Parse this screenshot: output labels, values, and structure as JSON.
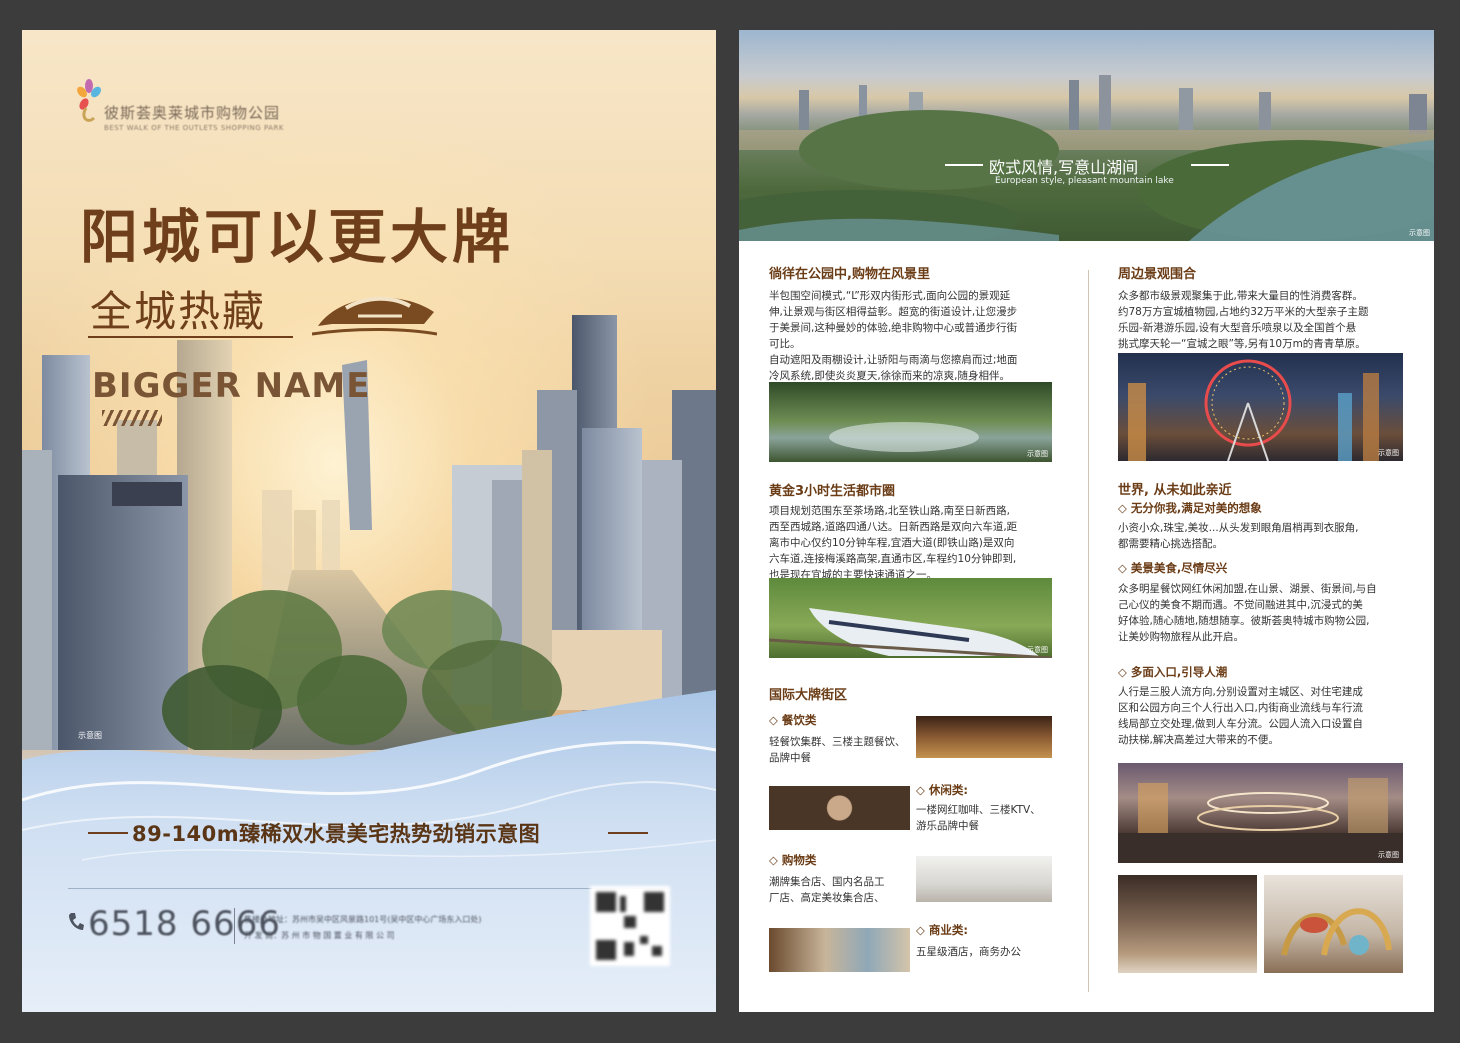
{
  "left": {
    "logo": {
      "name_cn": "彼斯荟奥莱城市购物公园",
      "name_en": "BEST WALK OF THE OUTLETS SHOPPING PARK"
    },
    "headline": "阳城可以更大牌",
    "subheadline": "全城热藏",
    "english_title": "BIGGER NAME",
    "photo_caption": "示意图",
    "tagline": "89-140m臻稀双水景美宅热势劲销示意图",
    "phone": "6518 6666",
    "address_line1": "售楼处地址：苏州市吴中区风景路101号(吴中区中心广场东入口处)",
    "address_line2": "开 发 商：苏 州 市 物 国 置 业 有 限 公 司",
    "colors": {
      "brown": "#6e3f1a",
      "blue_wave": "#b9d0ea"
    }
  },
  "right": {
    "banner": {
      "slogan_cn": "欧式风情,写意山湖间",
      "slogan_en": "European style, pleasant mountain lake",
      "caption": "示意图"
    },
    "col1": {
      "s1": {
        "title": "徜徉在公园中,购物在风景里",
        "lines": [
          "半包围空间模式,“L”形双内街形式,面向公园的景观延",
          "伸,让景观与街区相得益彰。超宽的街道设计,让您漫步",
          "于美景间,这种曼妙的体验,绝非购物中心或普通步行街",
          "可比。",
          "自动遮阳及雨棚设计,让骄阳与雨滴与您擦肩而过;地面",
          "冷风系统,即使炎炎夏天,徐徐而来的凉爽,随身相伴。"
        ],
        "caption": "示意图"
      },
      "s2": {
        "title": "黄金3小时生活都市圈",
        "lines": [
          "项目规划范围东至茶场路,北至铁山路,南至日新西路,",
          "西至西城路,道路四通八达。日新西路是双向六车道,距",
          "离市中心仅约10分钟车程,宜酒大道(即铁山路)是双向",
          "六车道,连接梅溪路高架,直通市区,车程约10分钟即到,",
          "也是现在宜城的主要快速通道之一。"
        ],
        "caption": "示意图"
      },
      "s3": {
        "title": "国际大牌街区",
        "items": [
          {
            "name": "◇ 餐饮类",
            "desc": [
              "轻餐饮集群、三楼主题餐饮、",
              "品牌中餐"
            ]
          },
          {
            "name": "◇ 休闲类:",
            "desc": [
              "一楼网红咖啡、三楼KTV、",
              "游乐品牌中餐"
            ]
          },
          {
            "name": "◇ 购物类",
            "desc": [
              "潮牌集合店、国内名品工",
              "厂店、高定美妆集合店、"
            ]
          },
          {
            "name": "◇ 商业类:",
            "desc": [
              "五星级酒店，商务办公"
            ]
          }
        ]
      }
    },
    "col2": {
      "s1": {
        "title": "周边景观围合",
        "lines": [
          "众多都市级景观聚集于此,带来大量目的性消费客群。",
          "约78万方宣城植物园,占地约32万平米的大型亲子主题",
          "乐园-新港游乐园,设有大型音乐喷泉以及全国首个悬",
          "挑式摩天轮一“宣城之眼”等,另有10万m的青青草原。"
        ],
        "caption": "示意图"
      },
      "s2": {
        "title": "世界, 从未如此亲近",
        "items": [
          {
            "name": "◇ 无分你我,满足对美的想象",
            "lines": [
              "小资小众,珠宝,美妆...从头发到眼角眉梢再到衣服角,",
              "都需要精心挑选搭配。"
            ]
          },
          {
            "name": "◇ 美景美食,尽情尽兴",
            "lines": [
              "众多明星餐饮网红休闲加盟,在山景、湖景、街景间,与自",
              "己心仪的美食不期而遇。不觉间融进其中,沉浸式的美",
              "好体验,随心随地,随想随享。彼斯荟奥特城市购物公园,",
              "让美妙购物旅程从此开启。"
            ]
          },
          {
            "name": "◇ 多面入口,引导人潮",
            "lines": [
              "人行是三股人流方向,分别设置对主城区、对住宅建成",
              "区和公园方向三个人行出入口,内街商业流线与车行流",
              "线局部立交处理,做到人车分流。公园人流入口设置自",
              "动扶梯,解决高差过大带来的不便。"
            ]
          }
        ],
        "caption": "示意图"
      }
    }
  }
}
